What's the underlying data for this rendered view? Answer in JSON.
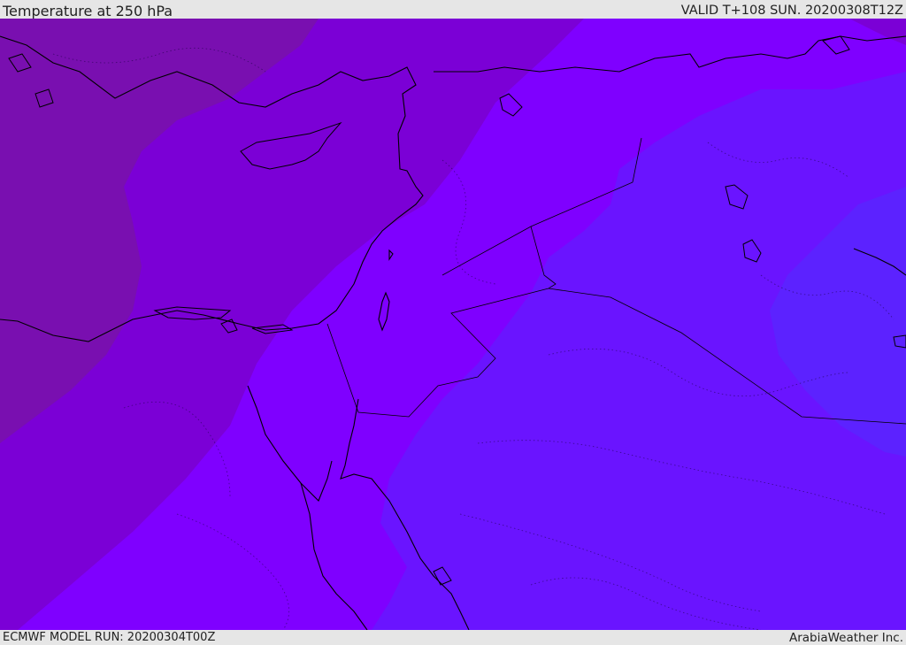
{
  "header": {
    "title": "Temperature at 250 hPa",
    "valid": "VALID T+108 SUN. 20200308T12Z"
  },
  "footer": {
    "model_run": "ECMWF MODEL RUN: 20200304T00Z",
    "credit": "ArabiaWeather Inc."
  },
  "map": {
    "colors": {
      "band_coldest_west": "#790fb0",
      "band_2": "#7b00d6",
      "band_3": "#7f00ff",
      "band_4": "#6a14ff",
      "band_5_east": "#5c22ff",
      "coastline": "#000000"
    },
    "layers": [
      "temperature-shading",
      "coastlines",
      "country-borders",
      "province-borders"
    ]
  }
}
